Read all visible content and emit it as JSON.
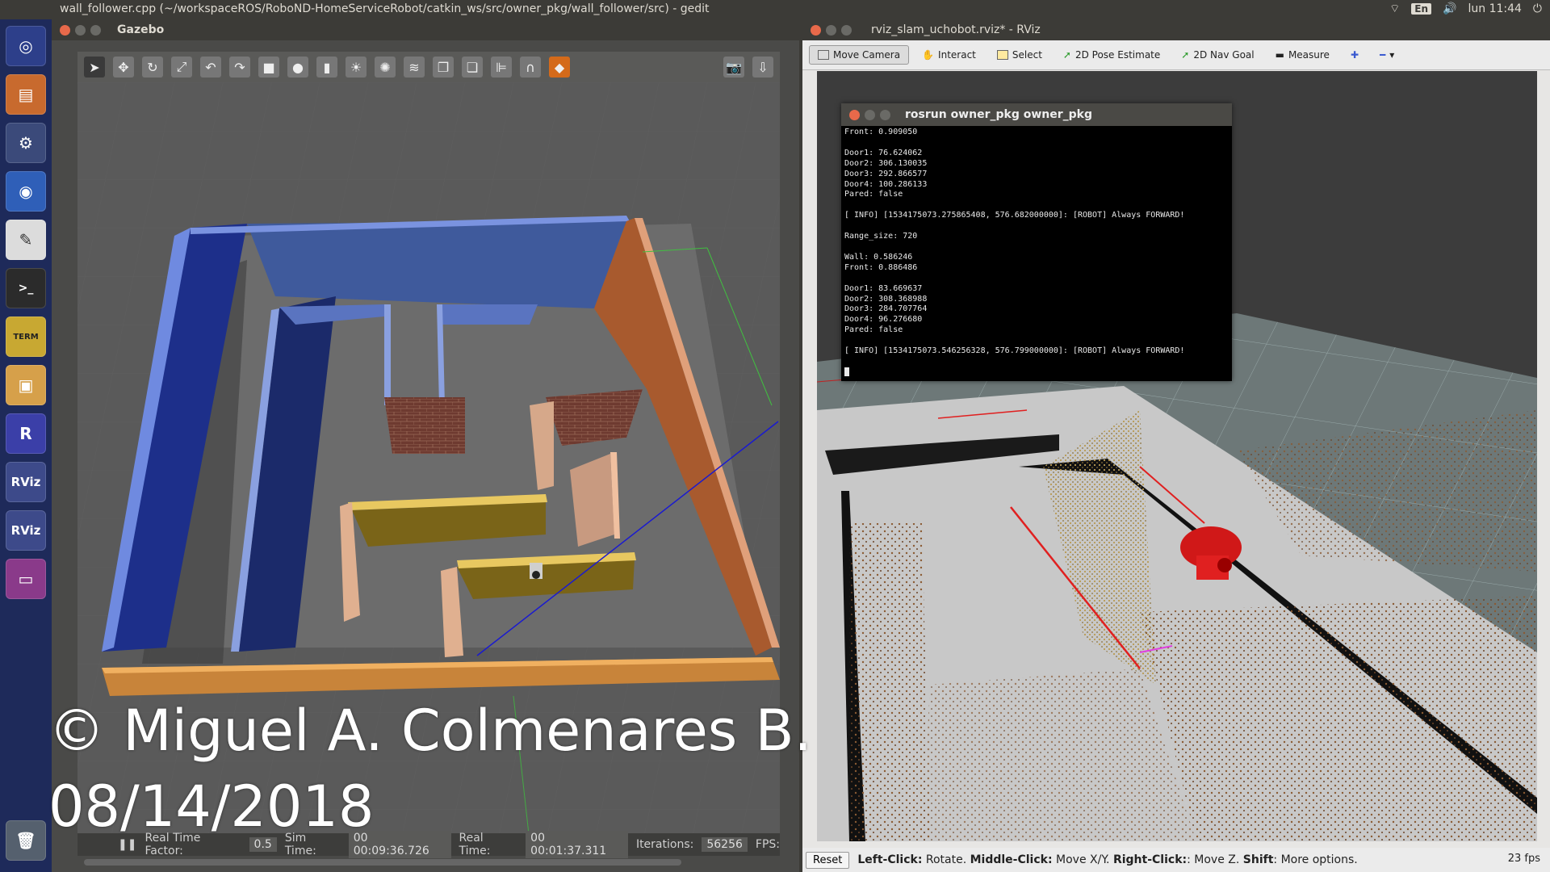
{
  "top_panel": {
    "window_title": "wall_follower.cpp (~/workspaceROS/RoboND-HomeServiceRobot/catkin_ws/src/owner_pkg/wall_follower/src) - gedit",
    "keyboard_layout": "En",
    "clock": "lun 11:44"
  },
  "launcher": {
    "items": [
      "ubuntu-icon",
      "files-icon",
      "settings-icon",
      "chromium-icon",
      "text-editor-icon",
      "terminal-icon",
      "xterm-icon",
      "virtualbox-icon",
      "rstudio-icon",
      "rviz-icon",
      "rviz-icon",
      "window-icon",
      "trash-icon"
    ],
    "rviz_label": "RViz",
    "rstudio_label": "R",
    "xterm_label": "TERM"
  },
  "gazebo": {
    "title": "Gazebo",
    "status": {
      "real_time_factor_label": "Real Time Factor:",
      "real_time_factor": "0.5",
      "sim_time_label": "Sim Time:",
      "sim_time": "00 00:09:36.726",
      "real_time_label": "Real Time:",
      "real_time": "00 00:01:37.311",
      "iterations_label": "Iterations:",
      "iterations": "56256",
      "fps_label": "FPS:"
    }
  },
  "rviz": {
    "title": "rviz_slam_uchobot.rviz* - RViz",
    "tools": {
      "move_camera": "Move Camera",
      "interact": "Interact",
      "select": "Select",
      "pose_estimate": "2D Pose Estimate",
      "nav_goal": "2D Nav Goal",
      "measure": "Measure"
    },
    "status": {
      "reset": "Reset",
      "help_1_key": "Left-Click:",
      "help_1": " Rotate. ",
      "help_2_key": "Middle-Click:",
      "help_2": " Move X/Y. ",
      "help_3_key": "Right-Click:",
      "help_3": ": Move Z. ",
      "help_4_key": "Shift",
      "help_4": ": More options.",
      "fps": "23 fps"
    }
  },
  "terminal": {
    "title": "rosrun owner_pkg owner_pkg",
    "lines": [
      "Front: 0.909050",
      "",
      "Door1: 76.624062",
      "Door2: 306.130035",
      "Door3: 292.866577",
      "Door4: 100.286133",
      "Pared: false",
      "",
      "[ INFO] [1534175073.275865408, 576.682000000]: [ROBOT] Always FORWARD!",
      "",
      "Range_size: 720",
      "",
      "Wall: 0.586246",
      "Front: 0.886486",
      "",
      "Door1: 83.669637",
      "Door2: 308.368988",
      "Door3: 284.707764",
      "Door4: 96.276680",
      "Pared: false",
      "",
      "[ INFO] [1534175073.546256328, 576.799000000]: [ROBOT] Always FORWARD!",
      ""
    ]
  },
  "watermark": {
    "line1": "© Miguel A. Colmenares B.",
    "line2": "08/14/2018"
  }
}
